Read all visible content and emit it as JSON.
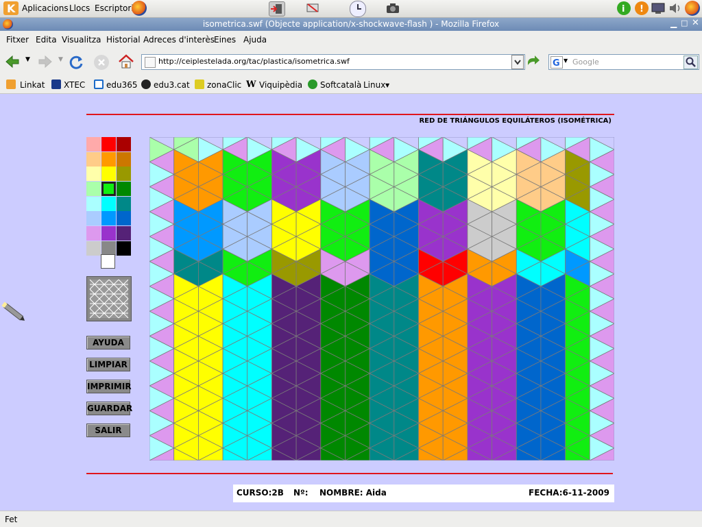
{
  "panel": {
    "menus": [
      "Aplicacions",
      "Llocs",
      "Escriptori"
    ]
  },
  "window": {
    "title": "isometrica.swf (Objecte application/x-shockwave-flash ) - Mozilla Firefox"
  },
  "menubar": [
    "Fitxer",
    "Edita",
    "Visualitza",
    "Historial",
    "Adreces d'interès",
    "Eines",
    "Ajuda"
  ],
  "navbar": {
    "url": "http://ceiplestelada.org/tac/plastica/isometrica.swf",
    "search_placeholder": "Google"
  },
  "bookmarks": [
    "Linkat",
    "XTEC",
    "edu365",
    "edu3.cat",
    "zonaClic",
    "Viquipèdia",
    "Softcatalà",
    "Linux"
  ],
  "app": {
    "heading": "RED DE TRIÁNGULOS EQUILÁTEROS (ISOMÉTRICA)",
    "buttons": [
      "AYUDA",
      "LIMPIAR",
      "IMPRIMIR",
      "GUARDAR",
      "SALIR"
    ],
    "selected_color": "#11ee11",
    "footer": {
      "curso": "CURSO:2B",
      "numero": "Nº:",
      "nombre": "NOMBRE: Aida",
      "fecha": "FECHA:6-11-2009"
    }
  },
  "palette": [
    [
      "#ffaaaa",
      "#ff0000",
      "#aa0000"
    ],
    [
      "#ffcc88",
      "#ff9900",
      "#cc7700"
    ],
    [
      "#ffffaa",
      "#ffff00",
      "#999900"
    ],
    [
      "#aaffaa",
      "#11ee11",
      "#008800"
    ],
    [
      "#aaffff",
      "#00ffff",
      "#008888"
    ],
    [
      "#aaccff",
      "#0099ff",
      "#0066cc"
    ],
    [
      "#dd99ee",
      "#9933cc",
      "#552277"
    ],
    [
      "#cccccc",
      "#888888",
      "#000000"
    ]
  ],
  "palette_extra": "#ffffff",
  "canvas": {
    "columns": 19,
    "rows": 13,
    "base_colors": [
      "#aaffff",
      "#dd99ee"
    ],
    "patches": [
      {
        "c": [
          0,
          1
        ],
        "r": [
          0,
          1
        ],
        "color": "#aaffaa"
      },
      {
        "c": [
          2,
          3
        ],
        "r": [
          0,
          0
        ],
        "color": "#ff0000"
      },
      {
        "c": [
          4,
          5
        ],
        "r": [
          0,
          0
        ],
        "color": "#ffaaaa"
      },
      {
        "c": [
          6,
          7
        ],
        "r": [
          0,
          0
        ],
        "color": "#11ee11"
      },
      {
        "c": [
          8,
          9
        ],
        "r": [
          0,
          0
        ],
        "color": "#0099ff"
      },
      {
        "c": [
          10,
          11
        ],
        "r": [
          0,
          0
        ],
        "color": "#ff9900"
      },
      {
        "c": [
          12,
          13
        ],
        "r": [
          0,
          0
        ],
        "color": "#cccccc"
      },
      {
        "c": [
          14,
          15
        ],
        "r": [
          0,
          0
        ],
        "color": "#9933cc"
      },
      {
        "c": [
          16,
          17
        ],
        "r": [
          0,
          0
        ],
        "color": "#ffff00"
      },
      {
        "c": [
          1,
          2
        ],
        "r": [
          1,
          3
        ],
        "color": "#ff9900"
      },
      {
        "c": [
          3,
          4
        ],
        "r": [
          1,
          3
        ],
        "color": "#11ee11"
      },
      {
        "c": [
          5,
          6
        ],
        "r": [
          1,
          3
        ],
        "color": "#9933cc"
      },
      {
        "c": [
          7,
          8
        ],
        "r": [
          1,
          3
        ],
        "color": "#aaccff"
      },
      {
        "c": [
          9,
          10
        ],
        "r": [
          1,
          3
        ],
        "color": "#aaffaa"
      },
      {
        "c": [
          11,
          12
        ],
        "r": [
          1,
          3
        ],
        "color": "#008888"
      },
      {
        "c": [
          13,
          14
        ],
        "r": [
          1,
          3
        ],
        "color": "#ffffaa"
      },
      {
        "c": [
          15,
          16
        ],
        "r": [
          1,
          3
        ],
        "color": "#ffcc88"
      },
      {
        "c": [
          17,
          17
        ],
        "r": [
          1,
          3
        ],
        "color": "#999900"
      },
      {
        "c": [
          1,
          2
        ],
        "r": [
          3,
          5
        ],
        "color": "#0099ff"
      },
      {
        "c": [
          3,
          4
        ],
        "r": [
          3,
          5
        ],
        "color": "#aaccff"
      },
      {
        "c": [
          5,
          6
        ],
        "r": [
          3,
          5
        ],
        "color": "#ffff00"
      },
      {
        "c": [
          7,
          8
        ],
        "r": [
          3,
          5
        ],
        "color": "#11ee11"
      },
      {
        "c": [
          9,
          10
        ],
        "r": [
          3,
          5
        ],
        "color": "#0066cc"
      },
      {
        "c": [
          11,
          12
        ],
        "r": [
          3,
          5
        ],
        "color": "#9933cc"
      },
      {
        "c": [
          13,
          14
        ],
        "r": [
          3,
          5
        ],
        "color": "#cccccc"
      },
      {
        "c": [
          15,
          16
        ],
        "r": [
          3,
          5
        ],
        "color": "#11ee11"
      },
      {
        "c": [
          17,
          17
        ],
        "r": [
          3,
          5
        ],
        "color": "#00ffff"
      },
      {
        "c": [
          1,
          2
        ],
        "r": [
          5,
          6
        ],
        "color": "#008888"
      },
      {
        "c": [
          3,
          4
        ],
        "r": [
          5,
          6
        ],
        "color": "#11ee11"
      },
      {
        "c": [
          5,
          6
        ],
        "r": [
          5,
          6
        ],
        "color": "#999900"
      },
      {
        "c": [
          7,
          8
        ],
        "r": [
          5,
          6
        ],
        "color": "#dd99ee"
      },
      {
        "c": [
          9,
          10
        ],
        "r": [
          5,
          6
        ],
        "color": "#0066cc"
      },
      {
        "c": [
          11,
          12
        ],
        "r": [
          5,
          6
        ],
        "color": "#ff0000"
      },
      {
        "c": [
          13,
          14
        ],
        "r": [
          5,
          6
        ],
        "color": "#ff9900"
      },
      {
        "c": [
          15,
          16
        ],
        "r": [
          5,
          6
        ],
        "color": "#00ffff"
      },
      {
        "c": [
          17,
          17
        ],
        "r": [
          5,
          6
        ],
        "color": "#0099ff"
      },
      {
        "c": [
          1,
          2
        ],
        "r": [
          6,
          13
        ],
        "color": "#ffff00"
      },
      {
        "c": [
          3,
          4
        ],
        "r": [
          6,
          13
        ],
        "color": "#00ffff"
      },
      {
        "c": [
          5,
          6
        ],
        "r": [
          6,
          13
        ],
        "color": "#552277"
      },
      {
        "c": [
          7,
          8
        ],
        "r": [
          6,
          13
        ],
        "color": "#008800"
      },
      {
        "c": [
          9,
          10
        ],
        "r": [
          6,
          13
        ],
        "color": "#008888"
      },
      {
        "c": [
          11,
          12
        ],
        "r": [
          6,
          13
        ],
        "color": "#ff9900"
      },
      {
        "c": [
          13,
          14
        ],
        "r": [
          6,
          13
        ],
        "color": "#9933cc"
      },
      {
        "c": [
          15,
          16
        ],
        "r": [
          6,
          13
        ],
        "color": "#0066cc"
      },
      {
        "c": [
          17,
          17
        ],
        "r": [
          6,
          13
        ],
        "color": "#11ee11"
      }
    ]
  }
}
